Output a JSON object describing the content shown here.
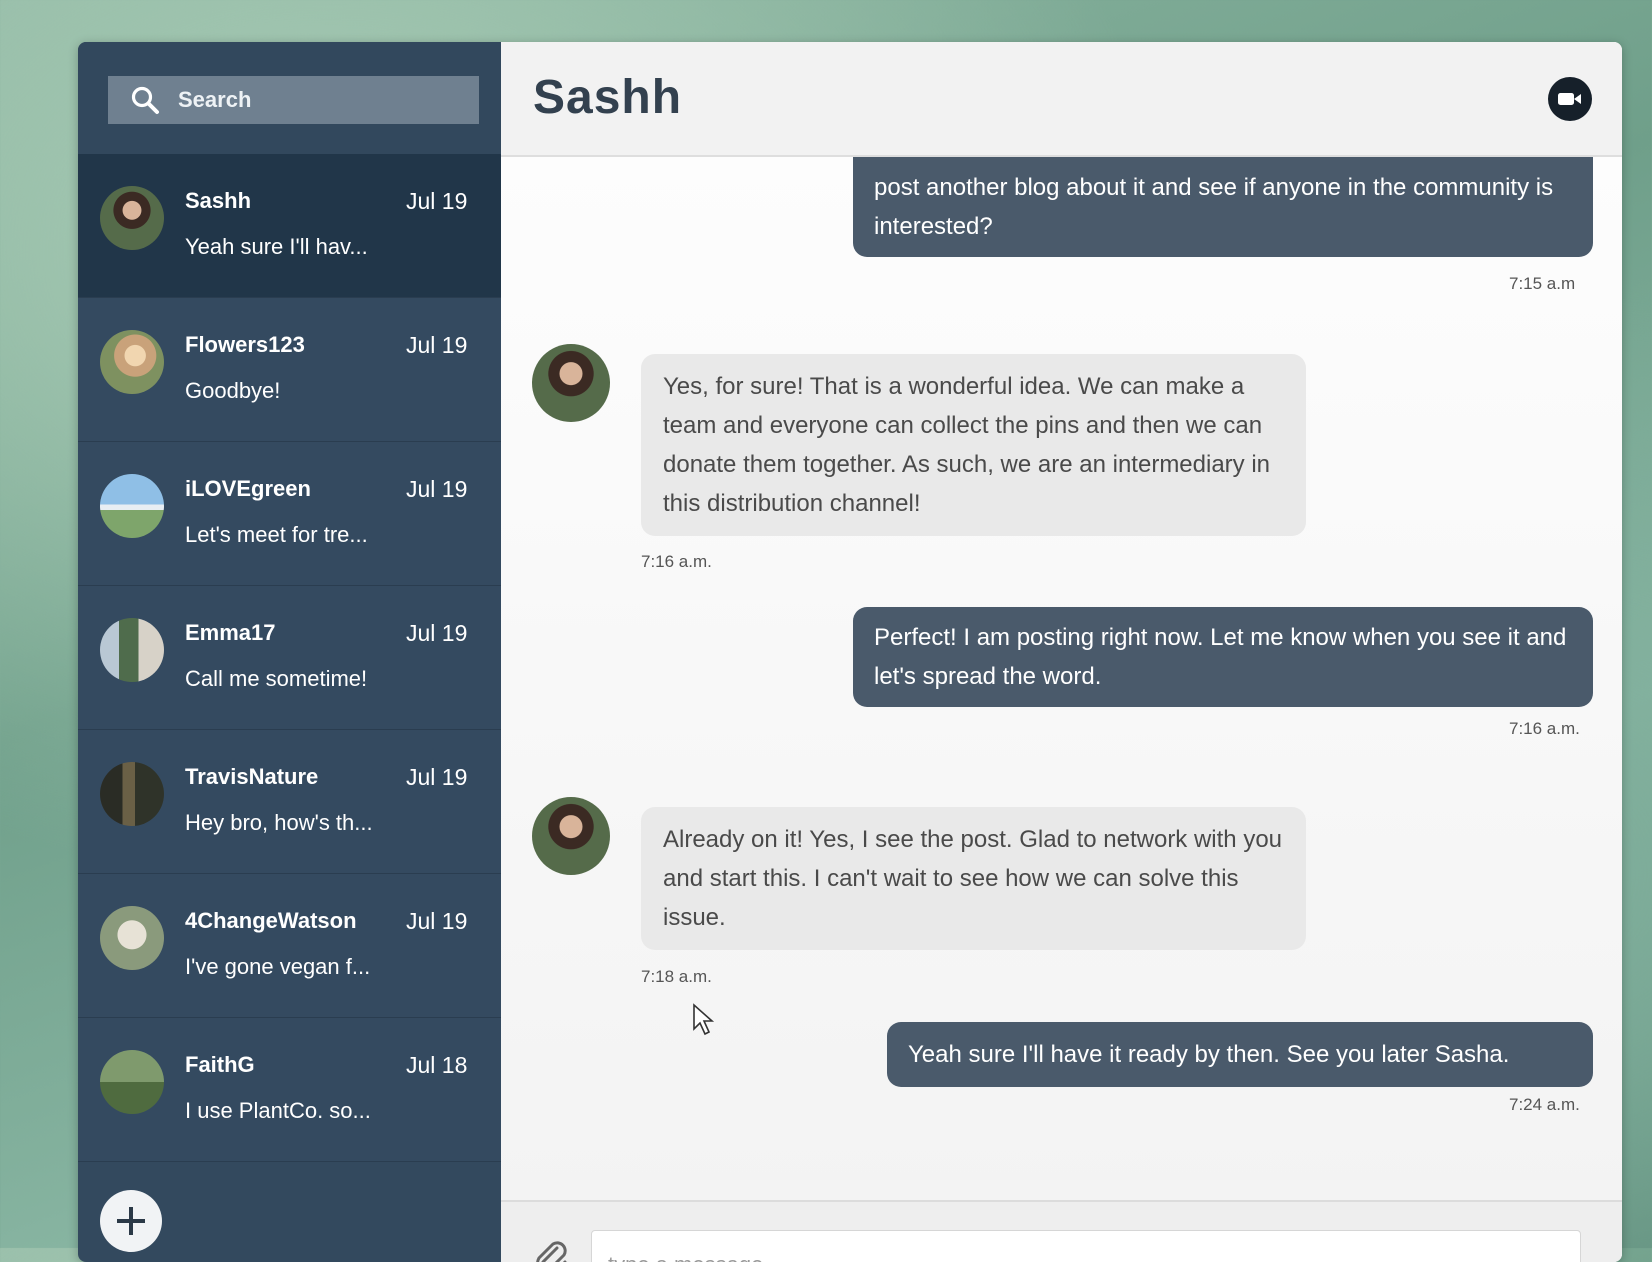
{
  "sidebar": {
    "search": {
      "placeholder": "Search"
    },
    "conversations": [
      {
        "name": "Sashh",
        "date": "Jul 19",
        "preview": "Yeah sure I'll hav...",
        "active": true
      },
      {
        "name": "Flowers123",
        "date": "Jul 19",
        "preview": "Goodbye!"
      },
      {
        "name": "iLOVEgreen",
        "date": "Jul 19",
        "preview": "Let's meet for tre..."
      },
      {
        "name": "Emma17",
        "date": "Jul 19",
        "preview": "Call me sometime!"
      },
      {
        "name": "TravisNature",
        "date": "Jul 19",
        "preview": "Hey bro, how's th..."
      },
      {
        "name": "4ChangeWatson",
        "date": "Jul 19",
        "preview": "I've gone vegan f..."
      },
      {
        "name": "FaithG",
        "date": "Jul 18",
        "preview": "I use PlantCo. so..."
      }
    ]
  },
  "chat": {
    "title": "Sashh",
    "messages": [
      {
        "text": "post another blog about it and see if anyone in the community is interested?",
        "time": "7:15 a.m"
      },
      {
        "text": "Yes, for sure! That is a wonderful idea. We can make a team and everyone can collect the pins and then we can donate them together. As such, we are an intermediary in this distribution channel!",
        "time": "7:16 a.m."
      },
      {
        "text": "Perfect! I am posting right now. Let me know when you see it and let's spread the word.",
        "time": "7:16 a.m."
      },
      {
        "text": "Already on it! Yes, I see the post. Glad to network with you and start this. I can't wait to see how we can solve this issue.",
        "time": "7:18 a.m."
      },
      {
        "text": "Yeah sure I'll have it ready by then. See you later Sasha.",
        "time": "7:24 a.m."
      }
    ],
    "input_placeholder": "type a message"
  },
  "colors": {
    "sidebar": "#33495e",
    "sidebar_active": "#213649",
    "outgoing_bubble": "#4a5a6b",
    "incoming_bubble": "#e9e9e9"
  },
  "icons": [
    "search-icon",
    "video-camera-icon",
    "paperclip-icon",
    "plus-icon",
    "mouse-cursor-icon"
  ]
}
